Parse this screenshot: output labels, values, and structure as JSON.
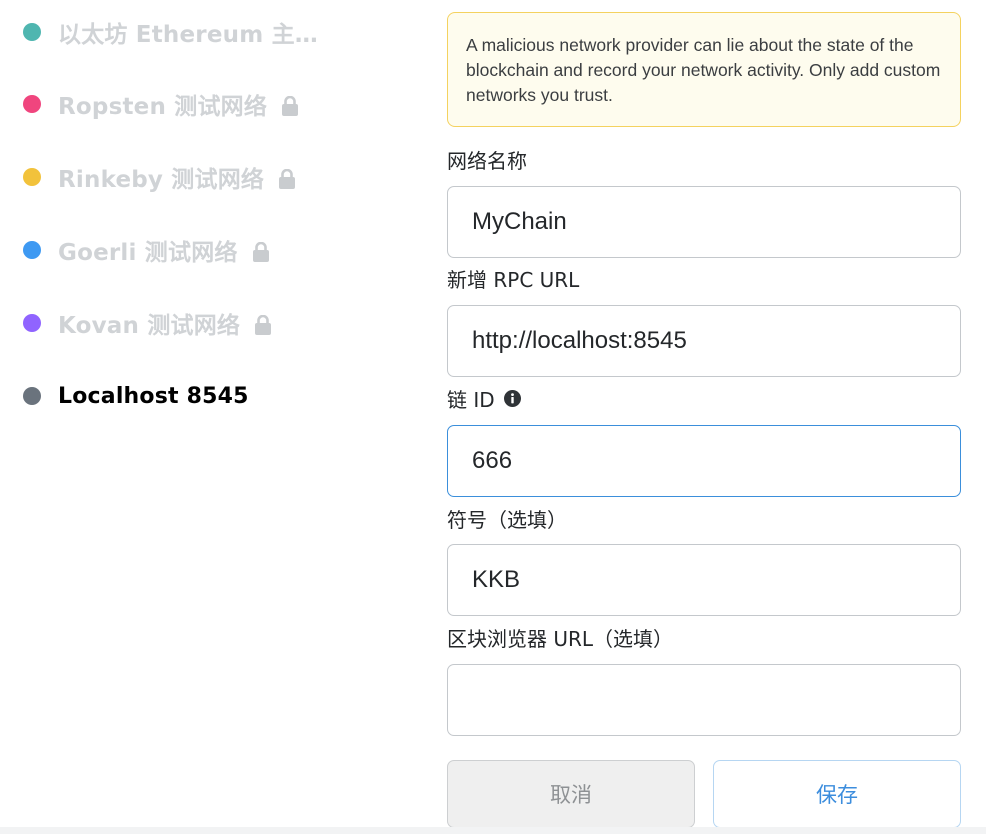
{
  "networks": [
    {
      "label": "以太坊 Ethereum 主网络",
      "color": "#4fb6b0",
      "locked": false,
      "active": false
    },
    {
      "label": "Ropsten 测试网络",
      "color": "#f0457e",
      "locked": true,
      "active": false
    },
    {
      "label": "Rinkeby 测试网络",
      "color": "#f2c23b",
      "locked": true,
      "active": false
    },
    {
      "label": "Goerli 测试网络",
      "color": "#3e99f2",
      "locked": true,
      "active": false
    },
    {
      "label": "Kovan 测试网络",
      "color": "#9064ff",
      "locked": true,
      "active": false
    },
    {
      "label": "Localhost 8545",
      "color": "#6a737d",
      "locked": false,
      "active": true
    }
  ],
  "warning": {
    "text": "A malicious network provider can lie about the state of the blockchain and record your network activity. Only add custom networks you trust."
  },
  "form": {
    "network_name": {
      "label": "网络名称",
      "value": "MyChain"
    },
    "rpc_url": {
      "label": "新增 RPC URL",
      "value": "http://localhost:8545"
    },
    "chain_id": {
      "label": "链 ID",
      "value": "666"
    },
    "symbol": {
      "label": "符号（选填）",
      "value": "KKB"
    },
    "explorer_url": {
      "label": "区块浏览器 URL（选填）",
      "value": ""
    }
  },
  "buttons": {
    "cancel_label": "取消",
    "save_label": "保存"
  },
  "icons": {
    "lock": "lock-icon",
    "info": "info-icon"
  },
  "colors": {
    "warning_border": "#f4d25f",
    "warning_bg": "#fefcee",
    "focus_border": "#3b8fdb",
    "save_text": "#3c8ddd"
  }
}
